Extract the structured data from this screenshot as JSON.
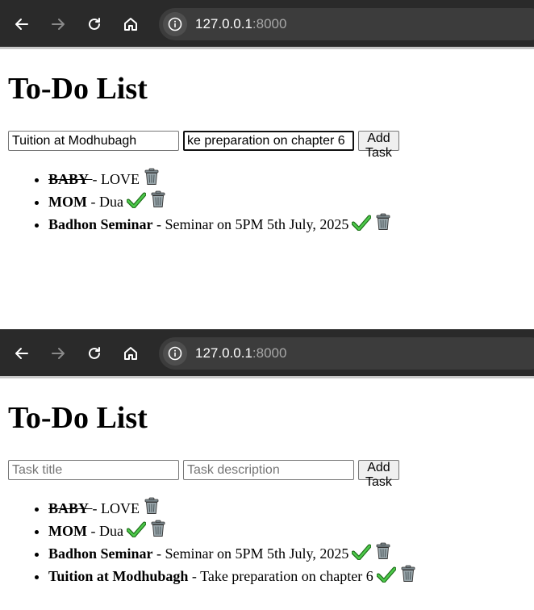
{
  "browser": {
    "url_host": "127.0.0.1",
    "url_port": ":8000",
    "icons": [
      "back-arrow-icon",
      "forward-arrow-icon",
      "reload-icon",
      "home-icon",
      "site-info-icon"
    ]
  },
  "screens": [
    {
      "heading": "To-Do List",
      "form": {
        "title_placeholder": "Task title",
        "title_value": "Tuition at Modhubagh",
        "desc_placeholder": "Task description",
        "desc_value": "ke preparation on chapter 6",
        "button_label": "Add Task"
      },
      "tasks": [
        {
          "title": "BABY",
          "desc": "LOVE",
          "completed": true
        },
        {
          "title": "MOM",
          "desc": "Dua",
          "completed": false
        },
        {
          "title": "Badhon Seminar",
          "desc": "Seminar on 5PM 5th July, 2025",
          "completed": false
        }
      ]
    },
    {
      "heading": "To-Do List",
      "form": {
        "title_placeholder": "Task title",
        "title_value": "",
        "desc_placeholder": "Task description",
        "desc_value": "",
        "button_label": "Add Task"
      },
      "tasks": [
        {
          "title": "BABY",
          "desc": "LOVE",
          "completed": true
        },
        {
          "title": "MOM",
          "desc": "Dua",
          "completed": false
        },
        {
          "title": "Badhon Seminar",
          "desc": "Seminar on 5PM 5th July, 2025",
          "completed": false
        },
        {
          "title": "Tuition at Modhubagh",
          "desc": "Take preparation on chapter 6",
          "completed": false
        }
      ]
    }
  ],
  "colors": {
    "toolbar": "#2a2a2a",
    "omnibox": "#3c3c3c",
    "link": "#0000ee",
    "check": "#3cb043"
  }
}
